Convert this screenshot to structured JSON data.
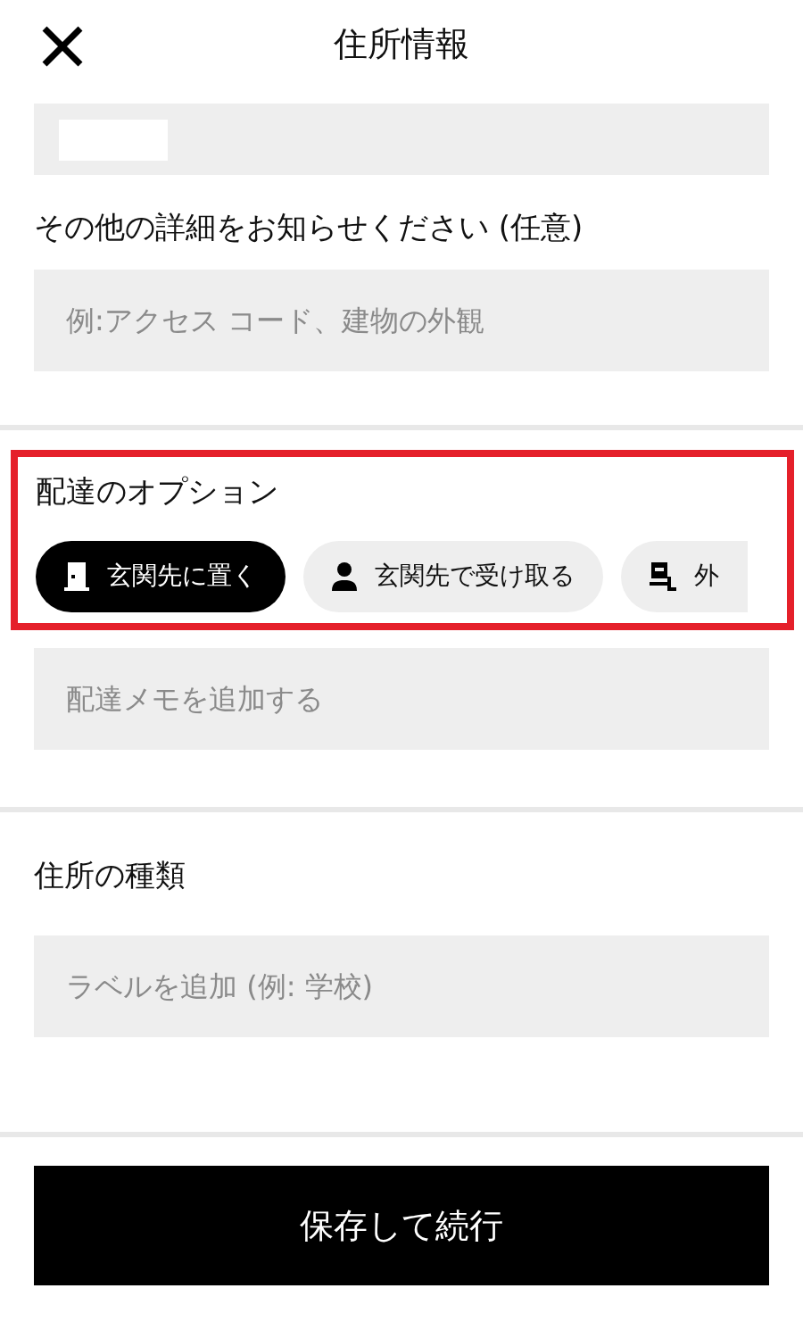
{
  "header": {
    "title": "住所情報"
  },
  "details": {
    "label": "その他の詳細をお知らせください (任意)",
    "placeholder": "例:アクセス コード、建物の外観"
  },
  "delivery": {
    "label": "配達のオプション",
    "highlighted": true,
    "options": [
      {
        "label": "玄関先に置く",
        "selected": true
      },
      {
        "label": "玄関先で受け取る",
        "selected": false
      },
      {
        "label": "外",
        "selected": false
      }
    ],
    "placeholder": "配達メモを追加する"
  },
  "address_type": {
    "label": "住所の種類",
    "placeholder": "ラベルを追加 (例: 学校)"
  },
  "save_button": "保存して続行"
}
